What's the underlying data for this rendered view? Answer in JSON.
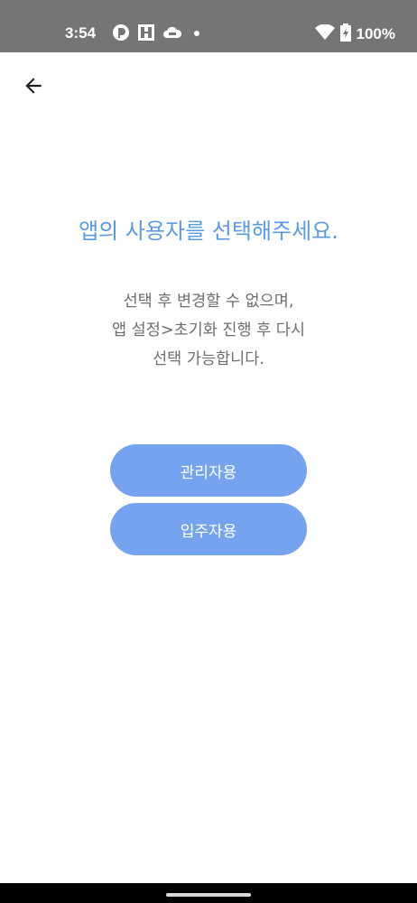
{
  "status_bar": {
    "time": "3:54",
    "battery": "100%",
    "icons": [
      "app-notification-icon",
      "grid-notification-icon",
      "cloud-notification-icon",
      "dot-icon",
      "wifi-icon",
      "battery-charging-icon"
    ]
  },
  "header": {
    "back_icon": "arrow-left-icon"
  },
  "main": {
    "title": "앱의 사용자를 선택해주세요.",
    "description_lines": [
      "선택 후 변경할 수 없으며,",
      "앱 설정>초기화 진행 후 다시",
      "선택 가능합니다."
    ],
    "buttons": [
      {
        "label": "관리자용"
      },
      {
        "label": "입주자용"
      }
    ]
  },
  "colors": {
    "accent_title": "#5b9be6",
    "button_bg": "#76a3f0",
    "status_bar_bg": "#757575"
  }
}
